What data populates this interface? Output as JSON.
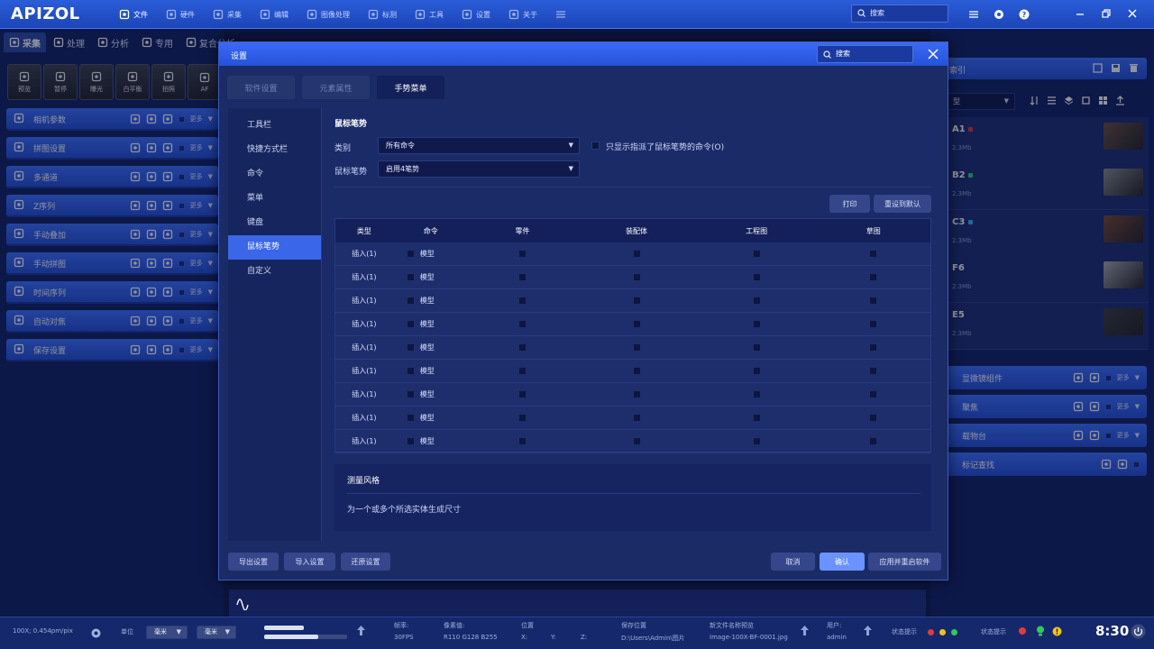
{
  "app": {
    "logo": "APIZOL",
    "search_placeholder": "搜索"
  },
  "top_menu": [
    {
      "label": "文件",
      "icon": "file-icon",
      "active": true
    },
    {
      "label": "硬件",
      "icon": "hardware-icon",
      "active": false
    },
    {
      "label": "采集",
      "icon": "capture-icon",
      "active": false
    },
    {
      "label": "编辑",
      "icon": "edit-icon",
      "active": false
    },
    {
      "label": "图像处理",
      "icon": "image-processing-icon",
      "active": false
    },
    {
      "label": "标测",
      "icon": "measure-icon",
      "active": false
    },
    {
      "label": "工具",
      "icon": "tools-icon",
      "active": false
    },
    {
      "label": "设置",
      "icon": "settings-icon",
      "active": false
    },
    {
      "label": "关于",
      "icon": "info-icon",
      "active": false
    }
  ],
  "left_tabs": [
    {
      "label": "采集",
      "active": true
    },
    {
      "label": "处理",
      "active": false
    },
    {
      "label": "分析",
      "active": false
    },
    {
      "label": "专用",
      "active": false
    },
    {
      "label": "复合分析",
      "active": false
    }
  ],
  "tools": [
    {
      "label": "预览",
      "icon": "eye-icon"
    },
    {
      "label": "暂停",
      "icon": "pause-icon"
    },
    {
      "label": "曝光",
      "icon": "sun-icon"
    },
    {
      "label": "白平衡",
      "icon": "white-balance-icon"
    },
    {
      "label": "拍照",
      "icon": "camera-icon"
    },
    {
      "label": "AF",
      "icon": "autofocus-icon"
    }
  ],
  "left_bars": [
    {
      "label": "相机参数",
      "icon": "camera-params-icon",
      "more": "更多"
    },
    {
      "label": "拼图设置",
      "icon": "puzzle-icon",
      "more": "更多"
    },
    {
      "label": "多通道",
      "icon": "channels-icon",
      "more": "更多"
    },
    {
      "label": "Z序列",
      "icon": "z-stack-icon",
      "more": "更多"
    },
    {
      "label": "手动叠加",
      "icon": "layers-icon",
      "more": "更多"
    },
    {
      "label": "手动拼图",
      "icon": "manual-stitch-icon",
      "more": "更多"
    },
    {
      "label": "时间序列",
      "icon": "time-series-icon",
      "more": "更多"
    },
    {
      "label": "自动对焦",
      "icon": "focus-icon",
      "more": "更多"
    },
    {
      "label": "保存设置",
      "icon": "save-icon",
      "more": "更多"
    }
  ],
  "right": {
    "header": "索引",
    "type_select": "型",
    "cards": [
      {
        "name": "A1",
        "size": "2.3Mb",
        "mark": "#e0383a",
        "thumb": "#6b5040"
      },
      {
        "name": "B2",
        "size": "2.3Mb",
        "mark": "#2fd07a",
        "thumb": "#8a8f88"
      },
      {
        "name": "C3",
        "size": "2.3Mb",
        "mark": "#33b7f0",
        "thumb": "#7a4a32"
      },
      {
        "name": "F6",
        "size": "2.3Mb",
        "mark": "",
        "thumb": "#a9adb0"
      },
      {
        "name": "E5",
        "size": "2.3Mb",
        "mark": "",
        "thumb": "#3c3c3c"
      }
    ],
    "bars": [
      {
        "label": "显微镜组件",
        "more": "更多"
      },
      {
        "label": "聚焦",
        "more": "更多"
      },
      {
        "label": "载物台",
        "more": "更多"
      },
      {
        "label": "标记查找",
        "more": ""
      }
    ]
  },
  "dialog": {
    "title": "设置",
    "search": "搜索",
    "tabs": [
      {
        "label": "软件设置",
        "active": false
      },
      {
        "label": "元素属性",
        "active": false
      },
      {
        "label": "手势菜单",
        "active": true
      }
    ],
    "nav": [
      {
        "label": "工具栏",
        "active": false
      },
      {
        "label": "快捷方式栏",
        "active": false
      },
      {
        "label": "命令",
        "active": false
      },
      {
        "label": "菜单",
        "active": false
      },
      {
        "label": "键盘",
        "active": false
      },
      {
        "label": "鼠标笔势",
        "active": true
      },
      {
        "label": "自定义",
        "active": false
      }
    ],
    "section_title": "鼠标笔势",
    "category_label": "类别",
    "category_value": "所有命令",
    "only_show_label": "只显示指派了鼠标笔势的命令(O)",
    "gesture_label": "鼠标笔势",
    "gesture_value": "启用4笔势",
    "print_label": "打印",
    "reset_label": "重设到默认",
    "table": {
      "headers": [
        "类型",
        "命令",
        "零件",
        "装配体",
        "工程图",
        "草图"
      ],
      "rows": [
        {
          "type": "插入(1)",
          "cmd": "模型"
        },
        {
          "type": "插入(1)",
          "cmd": "模型"
        },
        {
          "type": "插入(1)",
          "cmd": "模型"
        },
        {
          "type": "插入(1)",
          "cmd": "模型"
        },
        {
          "type": "插入(1)",
          "cmd": "模型"
        },
        {
          "type": "插入(1)",
          "cmd": "模型"
        },
        {
          "type": "插入(1)",
          "cmd": "模型"
        },
        {
          "type": "插入(1)",
          "cmd": "模型"
        },
        {
          "type": "插入(1)",
          "cmd": "模型"
        }
      ]
    },
    "desc_title": "测量风格",
    "desc_text": "为一个或多个所选实体生成尺寸",
    "footer_left": [
      "导出设置",
      "导入设置",
      "还原设置"
    ],
    "cancel": "取消",
    "confirm": "确认",
    "apply_restart": "应用并重启软件"
  },
  "status": {
    "scale": "100X; 0.454pm/pix",
    "unit_label": "单位",
    "unit1": "毫米",
    "unit2": "毫米",
    "fps_label": "帧率:",
    "fps": "30FPS",
    "pixel_label": "像素值:",
    "pixel": "R110 G128 B255",
    "pos_label": "位置",
    "pos_x": "X:",
    "pos_y": "Y:",
    "pos_z": "Z:",
    "save_label": "保存位置",
    "save_path": "D:\\Users\\Admin\\图片",
    "newfile_label": "新文件名称预览",
    "newfile": "Image-100X-BF-0001.jpg",
    "user_label": "用户:",
    "user": "admin",
    "state_label1": "状态提示",
    "state_label2": "状态提示",
    "time": "8:30",
    "colors": {
      "red": "#e23b3b",
      "yellow": "#f0c419",
      "green": "#34c759"
    }
  }
}
